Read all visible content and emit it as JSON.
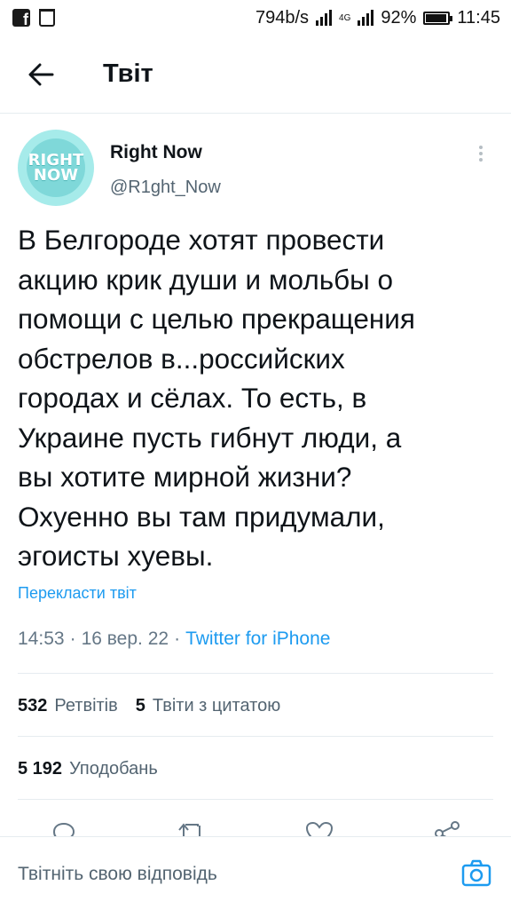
{
  "status_bar": {
    "net_speed": "794b/s",
    "network_type": "4G",
    "battery": "92%",
    "battery_level": 0.92,
    "time": "11:45",
    "icons": [
      "facebook-icon",
      "trash-icon",
      "signal-icon",
      "battery-icon"
    ]
  },
  "header": {
    "title": "Твіт",
    "back_icon": "arrow-left-icon"
  },
  "tweet": {
    "author": {
      "name": "Right Now",
      "handle": "@R1ght_Now",
      "avatar_line1": "RIGHT",
      "avatar_line2": "NOW"
    },
    "text": "В Белгороде хотят провести\nакцию крик души и мольбы о\nпомощи с целью прекращения\nобстрелов в...российских\nгородах и сёлах. То есть, в\nУкраине пусть гибнут люди, а\nвы хотите мирной жизни?\nОхуенно вы там придумали,\nэгоисты хуевы.",
    "translate_label": "Перекласти твіт",
    "time": "14:53",
    "separator": "·",
    "date": "16 вер. 22",
    "source": "Twitter for iPhone",
    "retweets_count": "532",
    "retweets_label": "Ретвітів",
    "quotes_count": "5",
    "quotes_label": "Твіти з цитатою",
    "likes_count": "5 192",
    "likes_label": "Уподобань"
  },
  "actions": [
    "reply-icon",
    "retweet-icon",
    "like-icon",
    "share-icon"
  ],
  "reply_bar": {
    "placeholder": "Твітніть свою відповідь",
    "camera_icon": "camera-icon"
  },
  "colors": {
    "accent": "#1d9bf0",
    "secondary_text": "#536471",
    "avatar_bg": "#a6ebea"
  }
}
